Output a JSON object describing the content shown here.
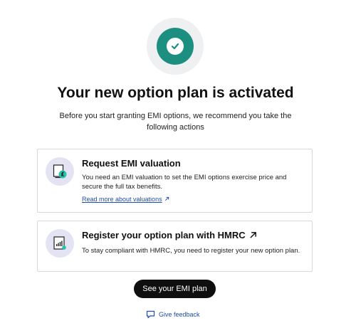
{
  "hero": {
    "icon": "check-circle-icon",
    "accent_color": "#1c8f80"
  },
  "title": "Your new option plan is activated",
  "subtitle": "Before you start granting EMI options, we recommend you take the following actions",
  "actions": [
    {
      "icon": "valuation-document-icon",
      "title": "Request EMI valuation",
      "description": "You need an EMI valuation to set the EMI options exercise price and secure the full tax benefits.",
      "link_label": "Read more about valuations"
    },
    {
      "icon": "register-document-icon",
      "title": "Register your option plan with HMRC",
      "description": "To stay compliant with HMRC, you need to register your new option plan."
    }
  ],
  "cta_label": "See your EMI plan",
  "feedback_label": "Give feedback",
  "colors": {
    "link": "#1f4fa8",
    "button": "#0f0f0f",
    "icon_bg": "#e3e3f3",
    "border": "#d5d8dc"
  }
}
